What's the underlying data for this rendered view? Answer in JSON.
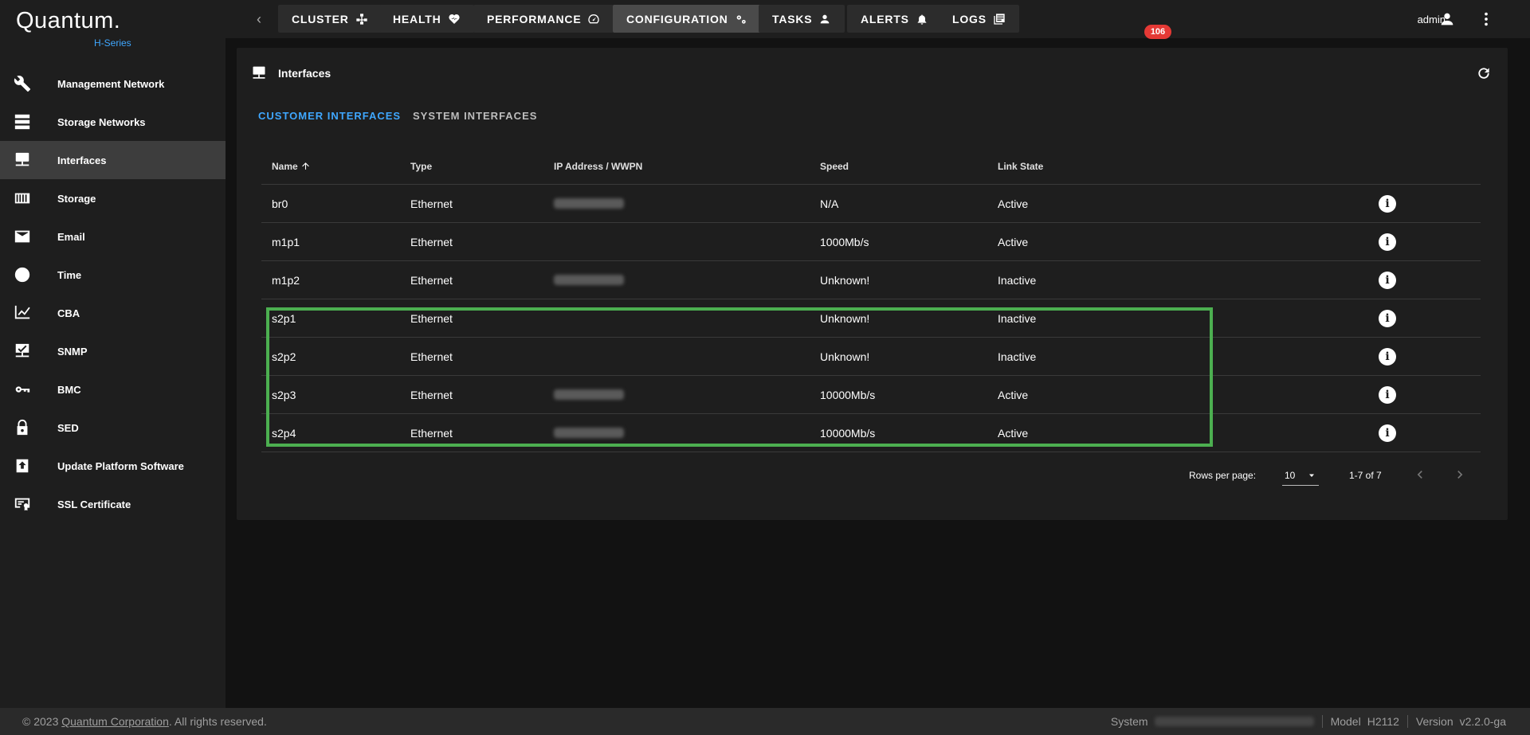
{
  "brand": {
    "name": "Quantum.",
    "series": "H-Series"
  },
  "sidebar": {
    "items": [
      {
        "label": "Management Network",
        "icon": "wrench-icon",
        "active": false
      },
      {
        "label": "Storage Networks",
        "icon": "server-icon",
        "active": false
      },
      {
        "label": "Interfaces",
        "icon": "monitor-network-icon",
        "active": true
      },
      {
        "label": "Storage",
        "icon": "storage-icon",
        "active": false
      },
      {
        "label": "Email",
        "icon": "email-icon",
        "active": false
      },
      {
        "label": "Time",
        "icon": "clock-icon",
        "active": false
      },
      {
        "label": "CBA",
        "icon": "chart-line-icon",
        "active": false
      },
      {
        "label": "SNMP",
        "icon": "monitor-check-icon",
        "active": false
      },
      {
        "label": "BMC",
        "icon": "key-icon",
        "active": false
      },
      {
        "label": "SED",
        "icon": "lock-icon",
        "active": false
      },
      {
        "label": "Update Platform Software",
        "icon": "upload-icon",
        "active": false
      },
      {
        "label": "SSL Certificate",
        "icon": "certificate-icon",
        "active": false
      }
    ]
  },
  "topnav": {
    "tabs": [
      {
        "label": "CLUSTER",
        "icon": "cluster-icon"
      },
      {
        "label": "HEALTH",
        "icon": "heart-pulse-icon"
      },
      {
        "label": "PERFORMANCE",
        "icon": "speedometer-icon"
      },
      {
        "label": "CONFIGURATION",
        "icon": "cogs-icon",
        "active": true
      },
      {
        "label": "TASKS",
        "icon": "account-icon"
      },
      {
        "label": "ALERTS",
        "icon": "bell-icon"
      },
      {
        "label": "LOGS",
        "icon": "logs-icon"
      }
    ],
    "alerts_count": "106",
    "user": "admin"
  },
  "page": {
    "title": "Interfaces",
    "subtabs": [
      "CUSTOMER INTERFACES",
      "SYSTEM INTERFACES"
    ],
    "active_subtab": "CUSTOMER INTERFACES"
  },
  "table": {
    "columns": [
      "Name",
      "Type",
      "IP Address / WWPN",
      "Speed",
      "Link State"
    ],
    "sort_icon": "arrow-up-icon",
    "rows": [
      {
        "name": "br0",
        "type": "Ethernet",
        "ip_masked": true,
        "speed": "N/A",
        "state": "Active"
      },
      {
        "name": "m1p1",
        "type": "Ethernet",
        "ip_masked": false,
        "speed": "1000Mb/s",
        "state": "Active"
      },
      {
        "name": "m1p2",
        "type": "Ethernet",
        "ip_masked": true,
        "speed": "Unknown!",
        "state": "Inactive"
      },
      {
        "name": "s2p1",
        "type": "Ethernet",
        "ip_masked": false,
        "speed": "Unknown!",
        "state": "Inactive"
      },
      {
        "name": "s2p2",
        "type": "Ethernet",
        "ip_masked": false,
        "speed": "Unknown!",
        "state": "Inactive"
      },
      {
        "name": "s2p3",
        "type": "Ethernet",
        "ip_masked": true,
        "speed": "10000Mb/s",
        "state": "Active"
      },
      {
        "name": "s2p4",
        "type": "Ethernet",
        "ip_masked": true,
        "speed": "10000Mb/s",
        "state": "Active"
      }
    ]
  },
  "pagination": {
    "rows_per_page_label": "Rows per page:",
    "rows_per_page": "10",
    "range": "1-7 of 7"
  },
  "footer": {
    "copyright_prefix": "© 2023",
    "company": "Quantum Corporation",
    "rights": ". All rights reserved.",
    "system_label": "System",
    "model_label": "Model",
    "model_value": "H2112",
    "version_label": "Version",
    "version_value": "v2.2.0-ga"
  },
  "colors": {
    "accent": "#3fa7ff",
    "highlight": "#4caf50",
    "badge": "#e53935"
  }
}
